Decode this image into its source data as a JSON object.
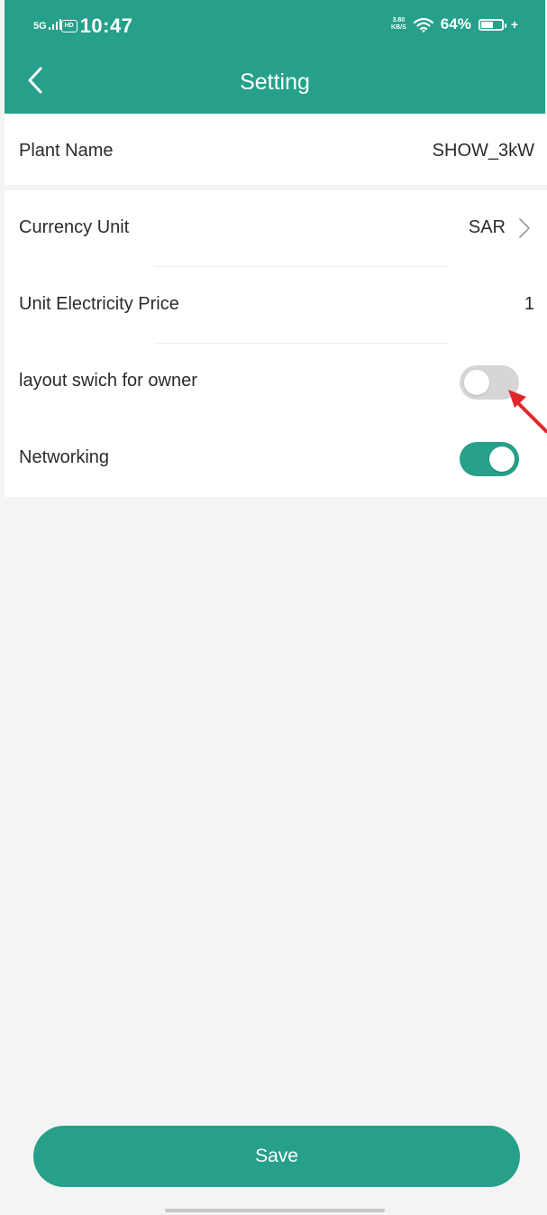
{
  "status_bar": {
    "network": "5G",
    "hd": "HD",
    "time": "10:47",
    "speed_value": "3.80",
    "speed_unit": "KB/S",
    "battery_percent": "64%",
    "battery_level": 0.64
  },
  "header": {
    "title": "Setting",
    "back_icon": "chevron-left-icon"
  },
  "settings": {
    "plant_name": {
      "label": "Plant Name",
      "value": "SHOW_3kW"
    },
    "currency_unit": {
      "label": "Currency Unit",
      "value": "SAR"
    },
    "unit_price": {
      "label": "Unit Electricity Price",
      "value": "1"
    },
    "layout_switch": {
      "label": "layout swich for owner",
      "enabled": false
    },
    "networking": {
      "label": "Networking",
      "enabled": true
    }
  },
  "save_label": "Save",
  "colors": {
    "brand": "#26a08a",
    "toggle_off": "#d6d6d6",
    "annotation_arrow": "#e0282c"
  }
}
